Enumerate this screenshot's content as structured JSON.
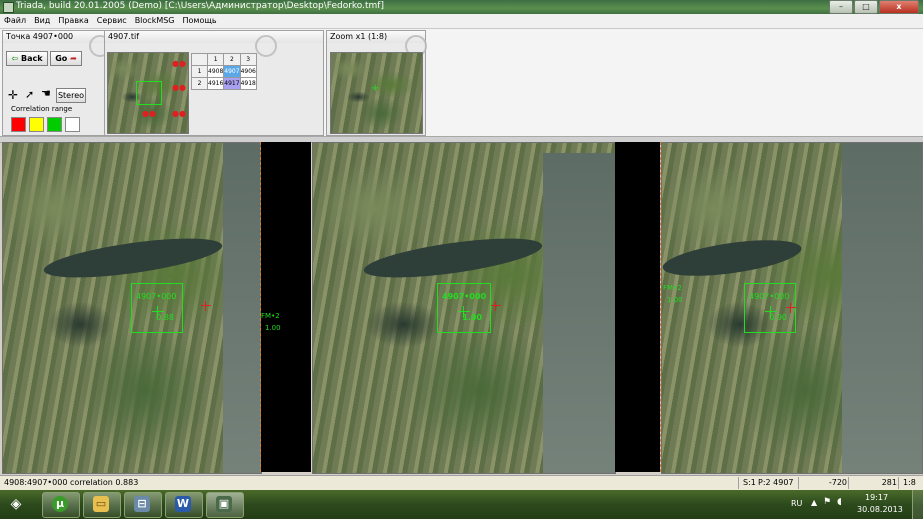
{
  "window": {
    "title": "Triada, build 20.01.2005 (Demo)  [C:\\Users\\Администратор\\Desktop\\Fedorko.tmf]",
    "min": "–",
    "max": "□",
    "close": "x"
  },
  "menu": [
    "Файл",
    "Вид",
    "Правка",
    "Сервис",
    "BlockMSG",
    "Помощь"
  ],
  "point_panel": {
    "title": "Точка 4907•000",
    "back_label": "Back",
    "go_label": "Go",
    "stereo_label": "Stereo",
    "correlation_label": "Correlation range",
    "swatches": [
      "#ff0000",
      "#ffff00",
      "#00cc00",
      "#ffffff"
    ]
  },
  "tif_panel": {
    "title": "4907.tif",
    "grid_header": [
      "",
      "1",
      "2",
      "3"
    ],
    "grid_rows": [
      [
        "1",
        "4908",
        "4907",
        "4906"
      ],
      [
        "2",
        "4916",
        "4917",
        "4918"
      ]
    ]
  },
  "zoom_panel": {
    "title": "Zoom x1 (1:8)"
  },
  "views": {
    "left": {
      "label": "4907•000",
      "value": "0.88",
      "edge_label": "FM•2",
      "edge_value": "1.00"
    },
    "center": {
      "label": "4907•000",
      "value": "1.00"
    },
    "right": {
      "label": "4907•000",
      "value": "0.90",
      "edge_label": "FM•2",
      "edge_value": "1.00"
    }
  },
  "status": {
    "message": "4908:4907•000 correlation 0.883",
    "scale": "S:1",
    "point": "P:2  4907",
    "x": "-720",
    "y": "281",
    "zoom": "1:8"
  },
  "taskbar": {
    "lang": "RU",
    "time": "19:17",
    "date": "30.08.2013",
    "apps": [
      "start-orb",
      "utorrent",
      "explorer",
      "network-drive",
      "word",
      "triada"
    ]
  }
}
